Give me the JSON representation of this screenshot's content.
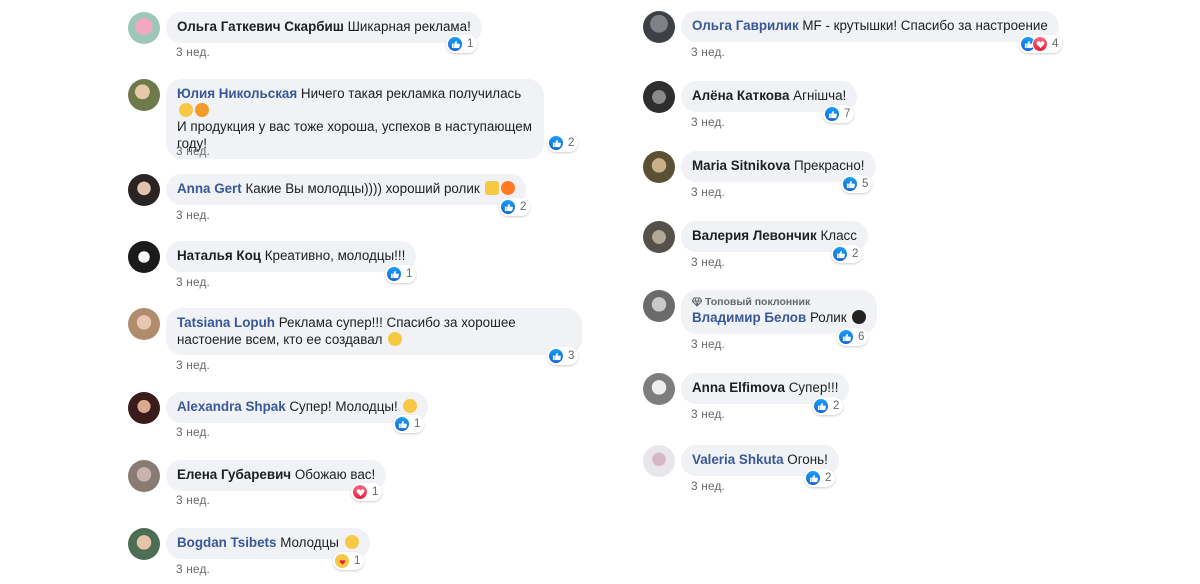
{
  "left": [
    {
      "author": "Ольга Гаткевич Скарбиш",
      "text": "Шикарная реклама!",
      "time": "3 нед.",
      "count": "1"
    },
    {
      "author": "Юлия Никольская",
      "text_lines": [
        "Ничего такая рекламка получилась",
        "И продукция у вас тоже хороша, успехов в наступающем",
        "году!"
      ],
      "time": "3 нед.",
      "count": "2"
    },
    {
      "author": "Anna Gert",
      "text": "Какие Вы молодцы)))) хороший ролик",
      "time": "3 нед.",
      "count": "2"
    },
    {
      "author": "Наталья Коц",
      "text": "Креативно, молодцы!!!",
      "time": "3 нед.",
      "count": "1"
    },
    {
      "author": "Tatsiana Lopuh",
      "text_lines": [
        "Реклама супер!!! Спасибо за хорошее",
        "настоение всем, кто ее создавал"
      ],
      "time": "3 нед.",
      "count": "3"
    },
    {
      "author": "Alexandra Shpak",
      "text": "Супер! Молодцы!",
      "time": "3 нед.",
      "count": "1"
    },
    {
      "author": "Елена Губаревич",
      "text": "Обожаю вас!",
      "time": "3 нед.",
      "count": "1"
    },
    {
      "author": "Bogdan Tsibets",
      "text": "Молодцы",
      "time": "3 нед.",
      "count": "1"
    }
  ],
  "right": [
    {
      "author": "Ольга Гаврилик",
      "text": "MF - крутышки! Спасибо за настроение",
      "time": "3 нед.",
      "count": "4"
    },
    {
      "author": "Алёна Каткова",
      "text": "Агнішча!",
      "time": "3 нед.",
      "count": "7"
    },
    {
      "author": "Maria Sitnikova",
      "text": "Прекрасно!",
      "time": "3 нед.",
      "count": "5"
    },
    {
      "author": "Валерия Левончик",
      "text": "Класс",
      "time": "3 нед.",
      "count": "2"
    },
    {
      "author": "Владимир Белов",
      "tag": "Топовый поклонник",
      "text": "Ролик",
      "time": "3 нед.",
      "count": "6"
    },
    {
      "author": "Anna Elfimova",
      "text": "Супер!!!",
      "time": "3 нед.",
      "count": "2"
    },
    {
      "author": "Valeria Shkuta",
      "text": "Огонь!",
      "time": "3 нед.",
      "count": "2"
    }
  ],
  "colors": {
    "bubble": "#f0f2f5",
    "link_name": "#385898",
    "meta": "#65676b",
    "like": "#1877f2",
    "love": "#e41e3f"
  }
}
